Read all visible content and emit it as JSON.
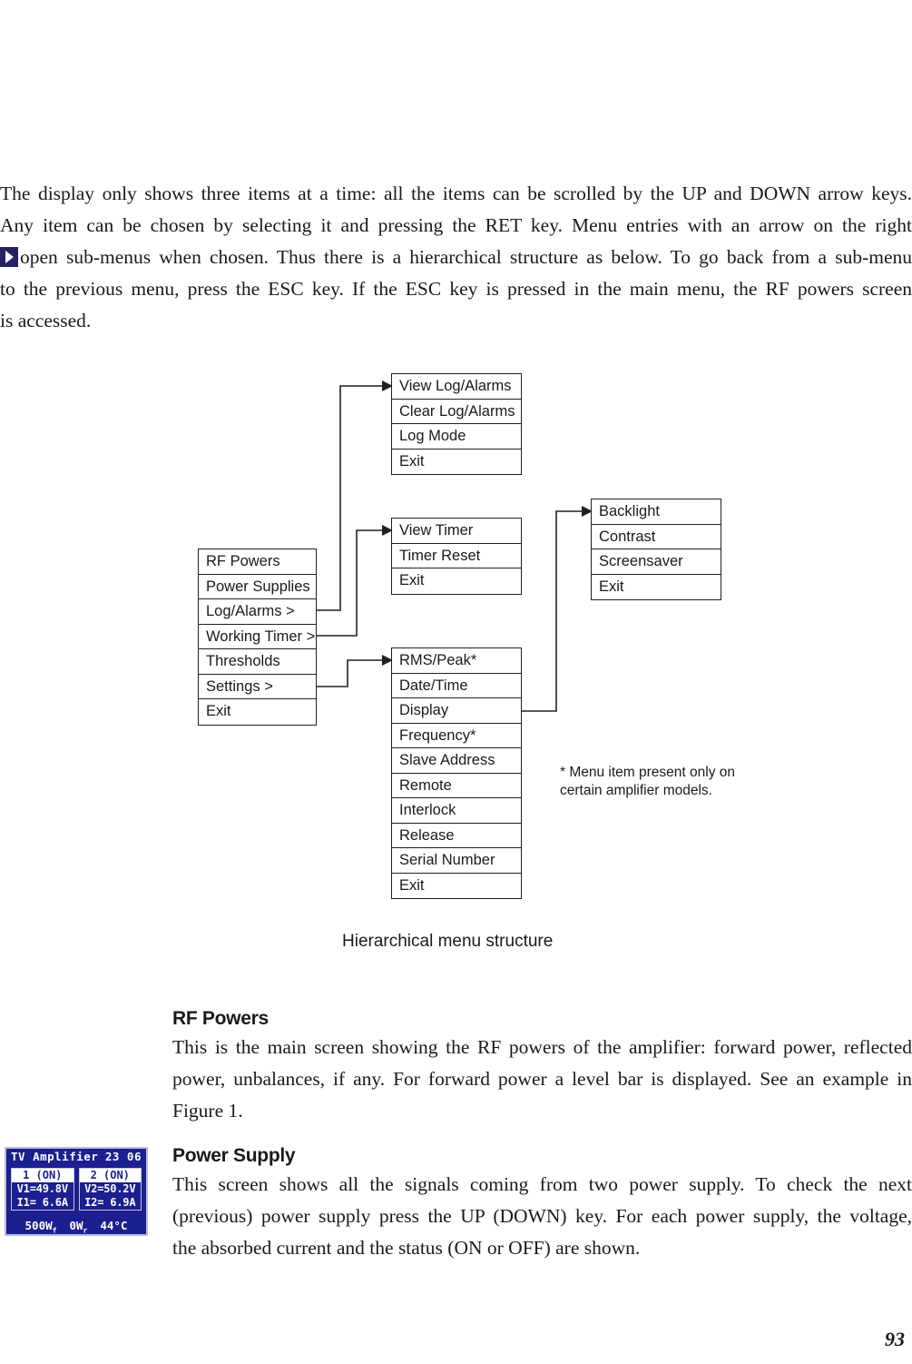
{
  "intro": {
    "lines": [
      "The display only shows three items at a time: all the items can be scrolled by the UP and DOWN arrow keys.",
      "Any item can be chosen by selecting it and pressing the RET key. Menu entries with an arrow on the right",
      "open sub-menus when chosen. Thus there is a hierarchical structure as below. To go back from a sub-menu",
      "to the previous menu, press the ESC key. If the ESC key is pressed in the main menu, the RF powers screen",
      "is accessed."
    ],
    "arrow_icon": "right-arrow-glyph"
  },
  "diagram": {
    "caption": "Hierarchical menu structure",
    "footnote": "* Menu item present only on certain amplifier models.",
    "boxes": {
      "main": {
        "name": "main-menu",
        "items": [
          "RF Powers",
          "Power Supplies",
          "Log/Alarms >",
          "Working Timer >",
          "Thresholds",
          "Settings >",
          "Exit"
        ]
      },
      "log_alarms": {
        "name": "log-alarms-submenu",
        "items": [
          "View Log/Alarms",
          "Clear Log/Alarms",
          "Log Mode",
          "Exit"
        ]
      },
      "working_timer": {
        "name": "working-timer-submenu",
        "items": [
          "View Timer",
          "Timer Reset",
          "Exit"
        ]
      },
      "settings": {
        "name": "settings-submenu",
        "items": [
          "RMS/Peak*",
          "Date/Time",
          "Display",
          "Frequency*",
          "Slave Address",
          "Remote",
          "Interlock",
          "Release",
          "Serial Number",
          "Exit"
        ]
      },
      "display": {
        "name": "display-submenu",
        "items": [
          "Backlight",
          "Contrast",
          "Screensaver",
          "Exit"
        ]
      }
    }
  },
  "sections": [
    {
      "heading": "RF Powers",
      "lines": [
        "This is the main screen showing the RF powers of the amplifier: forward power, reflected",
        "power, unbalances, if any. For forward power a level bar is displayed. See an example in",
        "Figure 1."
      ]
    },
    {
      "heading": "Power Supply",
      "lines": [
        "This screen shows all the signals coming from two power supply. To check the next",
        "(previous) power supply press the UP (DOWN) key. For each power supply, the voltage,",
        "the absorbed current and the status (ON or OFF) are shown."
      ]
    }
  ],
  "lcd": {
    "title": "TV Amplifier",
    "clock": "23 06",
    "cells": [
      {
        "header": "1 (ON)",
        "voltage": "V1=49.8V",
        "current": "I1= 6.6A"
      },
      {
        "header": "2 (ON)",
        "voltage": "V2=50.2V",
        "current": "I2= 6.9A"
      }
    ],
    "status": {
      "forward": "500W",
      "forward_sub": "f",
      "reflected": "0W",
      "reflected_sub": "r",
      "temperature": "44°C"
    },
    "colors": {
      "background": "#1b1f8f",
      "text": "#ffffff",
      "border": "#b9bcd6"
    }
  },
  "page_number": "93"
}
